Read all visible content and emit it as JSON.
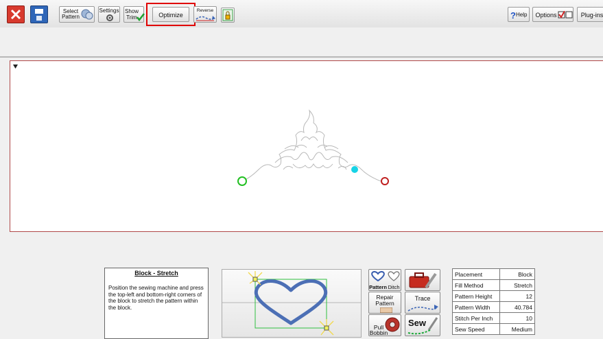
{
  "toolbar": {
    "select_pattern_label_1": "Select",
    "select_pattern_label_2": "Pattern",
    "settings_label": "Settings",
    "show_trim_label_1": "Show",
    "show_trim_label_2": "Trim",
    "optimize_label": "Optimize",
    "reverse_label": "Reverse",
    "help_label": "Help",
    "options_label": "Options",
    "plugins_label": "Plug-ins"
  },
  "instructions": {
    "title": "Block - Stretch",
    "body": "Position the sewing machine and press the top-left and bottom-right corners of the block to stretch the pattern within the block."
  },
  "mode_buttons": {
    "pattern_label": "Pattern",
    "ditch_label": "Ditch",
    "repair_label_1": "Repair",
    "repair_label_2": "Pattern",
    "trace_label": "Trace",
    "pull_label_1": "Pull",
    "pull_label_2": "Bobbin",
    "sew_label": "Sew"
  },
  "info_table": [
    {
      "key": "Placement",
      "value": "Block"
    },
    {
      "key": "Fill Method",
      "value": "Stretch"
    },
    {
      "key": "Pattern Height",
      "value": "12"
    },
    {
      "key": "Pattern Width",
      "value": "40.784"
    },
    {
      "key": "Stitch Per Inch",
      "value": "10"
    },
    {
      "key": "Sew Speed",
      "value": "Medium"
    }
  ],
  "colors": {
    "accent_highlight": "#e00000",
    "start_marker": "#22c022",
    "end_marker": "#c02020",
    "current_marker": "#17d3e6",
    "heart": "#4c6fb5",
    "block_outline": "#2fbf3f"
  },
  "icons": [
    "close-icon",
    "save-icon",
    "select-pattern-icon",
    "settings-gear-icon",
    "show-trim-check-icon",
    "reverse-arrow-icon",
    "lock-icon",
    "help-icon",
    "options-checkbox-icon"
  ]
}
